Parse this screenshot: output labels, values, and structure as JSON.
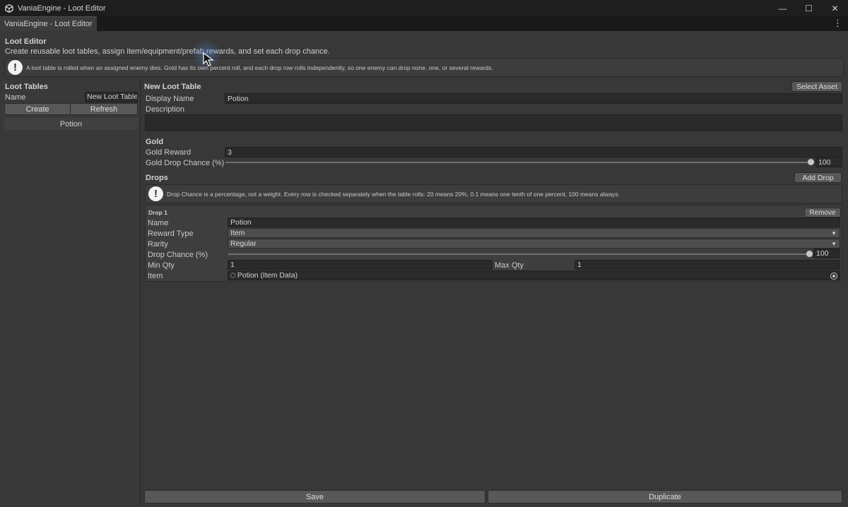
{
  "window": {
    "title": "VaniaEngine - Loot Editor",
    "controls": {
      "minimize": "—",
      "maximize": "☐",
      "close": "✕"
    }
  },
  "tab": {
    "label": "VaniaEngine - Loot Editor",
    "menu": "⋮"
  },
  "header": {
    "title": "Loot Editor",
    "subtitle": "Create reusable loot tables, assign item/equipment/prefab rewards, and set each drop chance.",
    "help_icon": "!",
    "help_text": "A loot table is rolled when an assigned enemy dies. Gold has its own percent roll, and each drop row rolls independently, so one enemy can drop none, one, or several rewards."
  },
  "sidebar": {
    "title": "Loot Tables",
    "name_label": "Name",
    "name_value": "New Loot Table",
    "create_label": "Create",
    "refresh_label": "Refresh",
    "items": [
      {
        "label": "Potion"
      }
    ]
  },
  "main": {
    "title": "New Loot Table",
    "select_asset_label": "Select Asset",
    "display_name_label": "Display Name",
    "display_name_value": "Potion",
    "description_label": "Description",
    "description_value": "",
    "gold": {
      "section_label": "Gold",
      "reward_label": "Gold Reward",
      "reward_value": "3",
      "chance_label": "Gold Drop Chance (%)",
      "chance_value": "100",
      "chance_fraction": 1.0
    },
    "drops": {
      "section_label": "Drops",
      "add_label": "Add Drop",
      "help_icon": "!",
      "help_text": "Drop Chance is a percentage, not a weight. Every row is checked separately when the table rolls: 20 means 20%, 0.1 means one tenth of one percent, 100 means always.",
      "rows": [
        {
          "title": "Drop 1",
          "remove_label": "Remove",
          "name_label": "Name",
          "name_value": "Potion",
          "reward_type_label": "Reward Type",
          "reward_type_value": "Item",
          "rarity_label": "Rarity",
          "rarity_value": "Regular",
          "chance_label": "Drop Chance (%)",
          "chance_value": "100",
          "chance_fraction": 1.0,
          "min_qty_label": "Min Qty",
          "min_qty_value": "1",
          "max_qty_label": "Max Qty",
          "max_qty_value": "1",
          "item_label": "Item",
          "item_value": "Potion (Item Data)"
        }
      ]
    },
    "save_label": "Save",
    "duplicate_label": "Duplicate"
  },
  "colors": {
    "background": "#383838",
    "titlebar": "#1e1e1e",
    "button": "#585858",
    "input": "#2a2a2a",
    "cursor_glow": "#508cdc"
  }
}
